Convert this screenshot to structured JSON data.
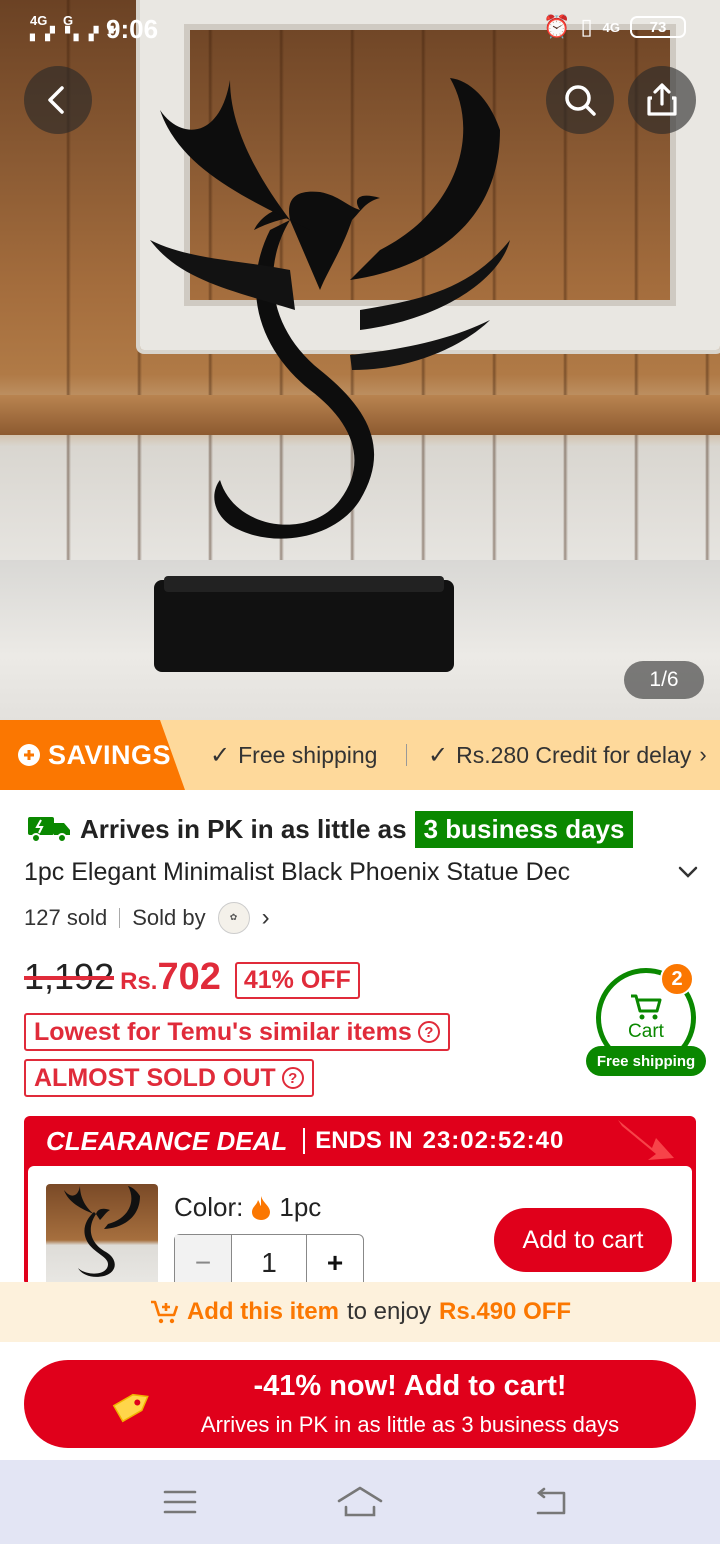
{
  "status_bar": {
    "signal_1": "4G",
    "signal_2": "G",
    "time": "9:06",
    "network": "4G",
    "battery": "73"
  },
  "gallery": {
    "page_indicator": "1/6"
  },
  "savings_banner": {
    "label": "SAVINGS",
    "perk_1": "Free shipping",
    "perk_2": "Rs.280 Credit for delay"
  },
  "product": {
    "arrival_prefix": "Arrives in PK in as little as",
    "arrival_days": "3 business days",
    "title": "1pc Elegant Minimalist Black Phoenix Statue Dec",
    "sold": "127 sold",
    "sold_by": "Sold by",
    "old_price": "1,192",
    "currency": "Rs.",
    "price": "702",
    "discount": "41% OFF",
    "lowest_badge": "Lowest for Temu's similar items",
    "almost_sold": "ALMOST SOLD OUT"
  },
  "cart_widget": {
    "label": "Cart",
    "count": "2",
    "free_shipping": "Free shipping"
  },
  "clearance": {
    "label": "CLEARANCE DEAL",
    "ends_label": "ENDS IN",
    "timer": "23:02:52:40",
    "color_label": "Color:",
    "color_value": "1pc",
    "quantity": "1",
    "add_button": "Add to cart"
  },
  "promo": {
    "highlight": "Add this item",
    "middle": "to enjoy",
    "amount": "Rs.490 OFF"
  },
  "cta": {
    "line1": "-41% now! Add to cart!",
    "line2": "Arrives in PK in as little as 3 business days"
  },
  "colors": {
    "brand_orange": "#fb7701",
    "deal_red": "#e0001b",
    "green": "#0a8800"
  }
}
